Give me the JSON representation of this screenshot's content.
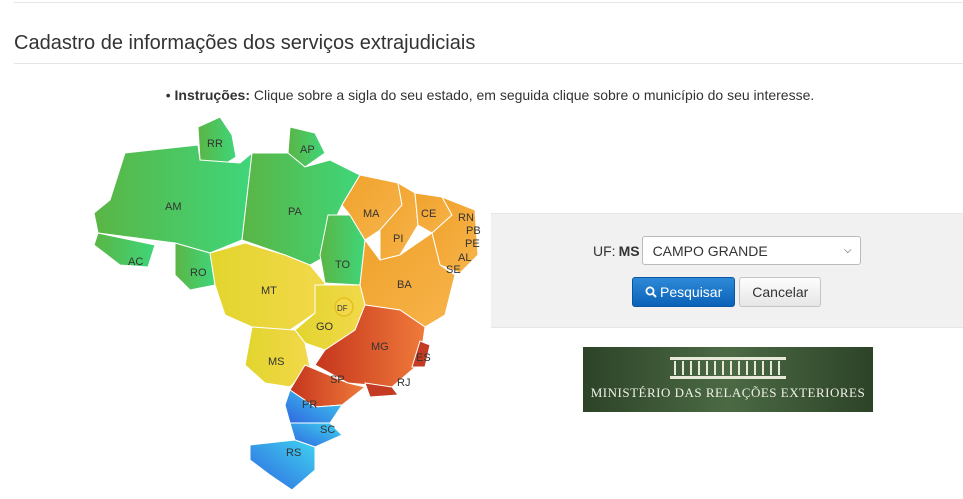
{
  "page": {
    "title": "Cadastro de informações dos serviços extrajudiciais",
    "instructions_label": "Instruções:",
    "instructions_text": " Clique sobre a sigla do seu estado, em seguida clique sobre o município do seu interesse."
  },
  "map": {
    "states": [
      "RR",
      "AP",
      "AM",
      "PA",
      "MA",
      "CE",
      "RN",
      "PB",
      "PE",
      "AL",
      "SE",
      "PI",
      "AC",
      "RO",
      "TO",
      "BA",
      "MT",
      "DF",
      "GO",
      "MG",
      "ES",
      "MS",
      "SP",
      "RJ",
      "PR",
      "SC",
      "RS"
    ],
    "colors": {
      "north": "#3cbf5a",
      "northeast": "#f2a531",
      "center_west": "#e6d534",
      "southeast": "#d4502a",
      "south": "#2f8ae0"
    }
  },
  "form": {
    "uf_label": "UF:",
    "uf_value": "MS",
    "municipio_selected": "CAMPO GRANDE",
    "search_label": "Pesquisar",
    "cancel_label": "Cancelar"
  },
  "banner": {
    "text": "MINISTÉRIO DAS RELAÇÕES EXTERIORES"
  }
}
